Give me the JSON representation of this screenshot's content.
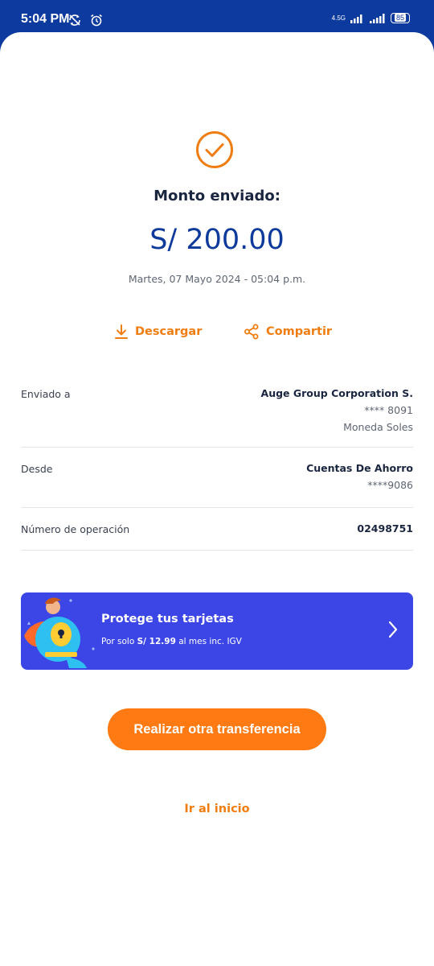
{
  "status_bar": {
    "time": "5:04 PM",
    "network_label": "4.5G",
    "battery": "85",
    "icons": [
      "no-sync-icon",
      "alarm-icon",
      "signal-icon",
      "signal-icon",
      "battery-icon"
    ]
  },
  "receipt": {
    "sent_label": "Monto enviado:",
    "amount": "S/ 200.00",
    "datetime": "Martes, 07 Mayo 2024 - 05:04 p.m.",
    "download_label": "Descargar",
    "share_label": "Compartir"
  },
  "details": {
    "sent_to": {
      "label": "Enviado a",
      "name": "Auge Group Corporation S.",
      "account": "**** 8091",
      "currency": "Moneda Soles"
    },
    "from": {
      "label": "Desde",
      "name": "Cuentas De Ahorro",
      "account": "****9086"
    },
    "operation": {
      "label": "Número de operación",
      "number": "02498751"
    }
  },
  "promo": {
    "title": "Protege tus tarjetas",
    "sub_prefix": "Por solo",
    "sub_price": "S/ 12.99",
    "sub_suffix": "al mes inc. IGV"
  },
  "actions": {
    "primary": "Realizar otra transferencia",
    "home": "Ir al inicio"
  },
  "colors": {
    "brand_blue": "#0d3a9e",
    "accent_orange": "#f07d12",
    "promo_blue": "#3c46e6"
  }
}
